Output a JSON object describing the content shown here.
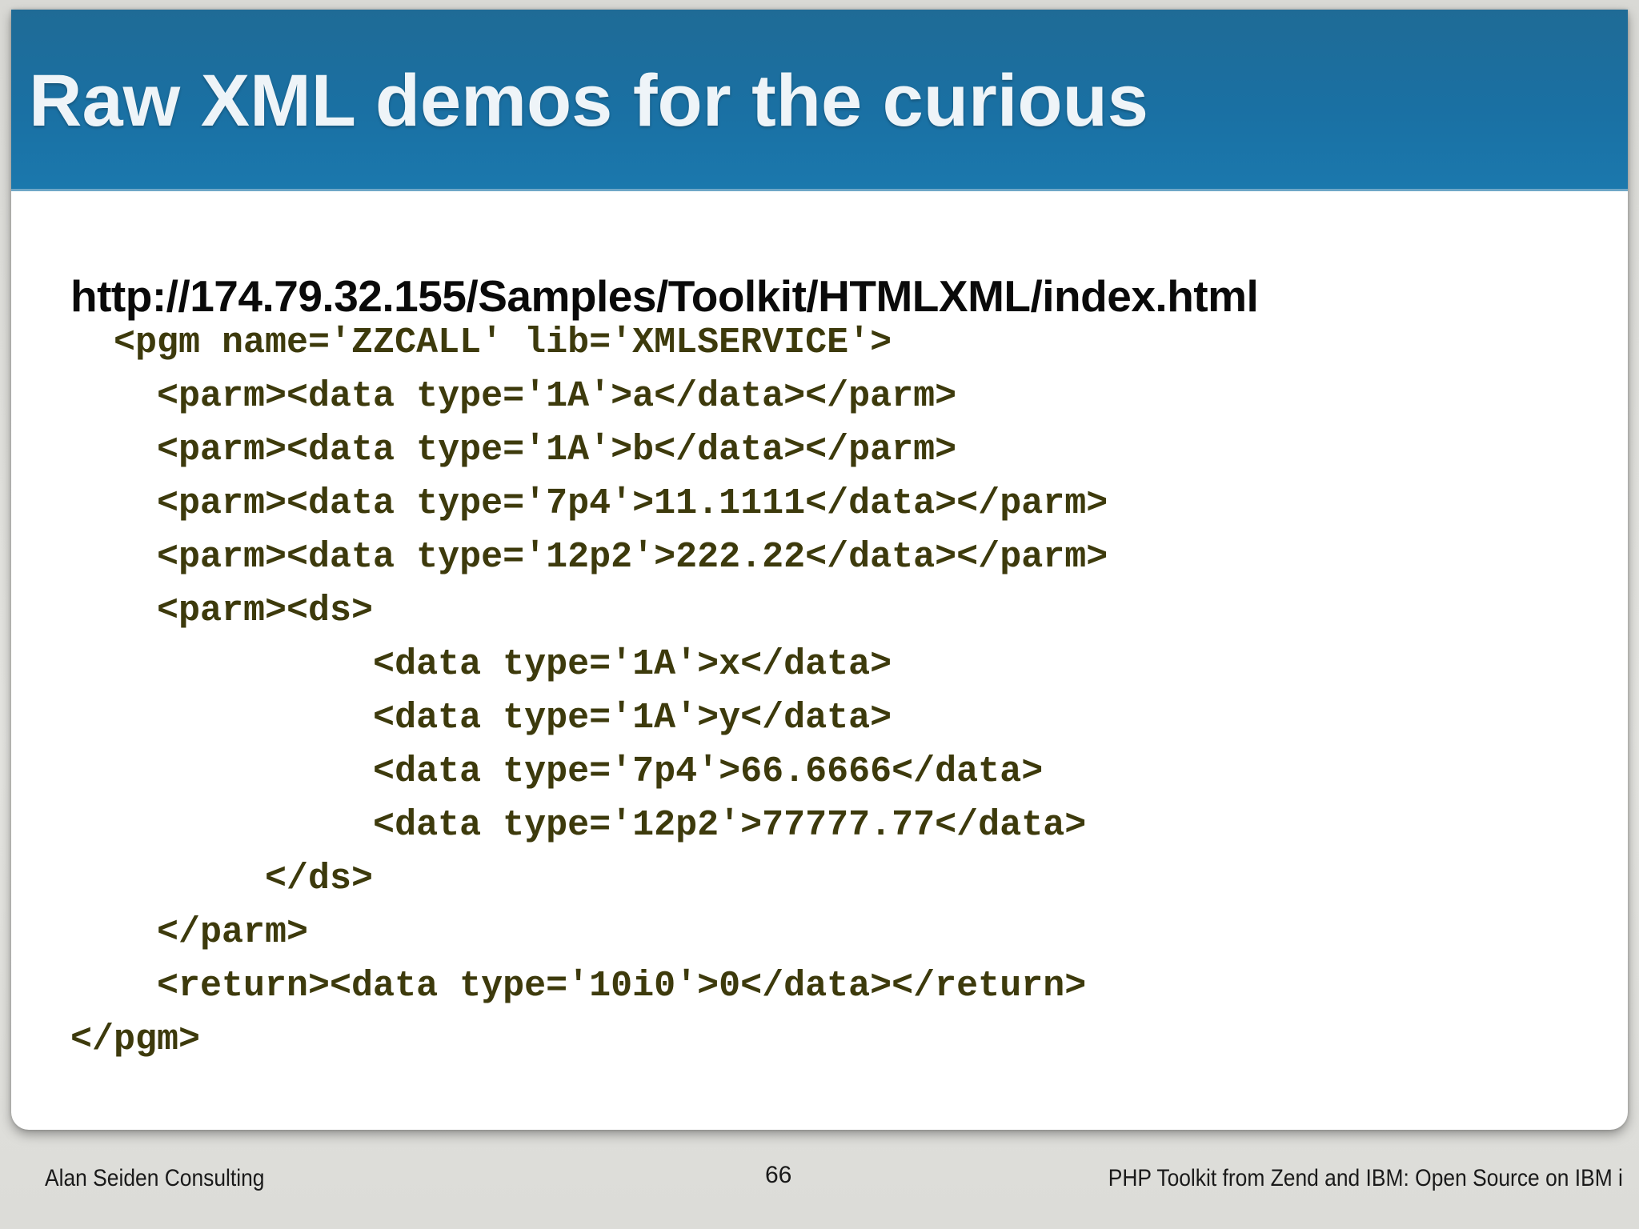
{
  "slide": {
    "title": "Raw XML demos for the curious",
    "url": "http://174.79.32.155/Samples/Toolkit/HTMLXML/index.html",
    "code_lines": [
      "  <pgm name='ZZCALL' lib='XMLSERVICE'>",
      "    <parm><data type='1A'>a</data></parm>",
      "    <parm><data type='1A'>b</data></parm>",
      "    <parm><data type='7p4'>11.1111</data></parm>",
      "    <parm><data type='12p2'>222.22</data></parm>",
      "    <parm><ds>",
      "              <data type='1A'>x</data>",
      "              <data type='1A'>y</data>",
      "              <data type='7p4'>66.6666</data>",
      "              <data type='12p2'>77777.77</data>",
      "         </ds>",
      "    </parm>",
      "    <return><data type='10i0'>0</data></return>",
      "</pgm>"
    ]
  },
  "footer": {
    "left": "Alan Seiden Consulting",
    "page_number": "66",
    "right": "PHP Toolkit from Zend and IBM: Open Source on IBM i"
  },
  "colors": {
    "title_bar": "#1a70a3",
    "title_text": "#eef4f8",
    "code_text": "#3d3a0c",
    "url_text": "#0a0a0a"
  }
}
